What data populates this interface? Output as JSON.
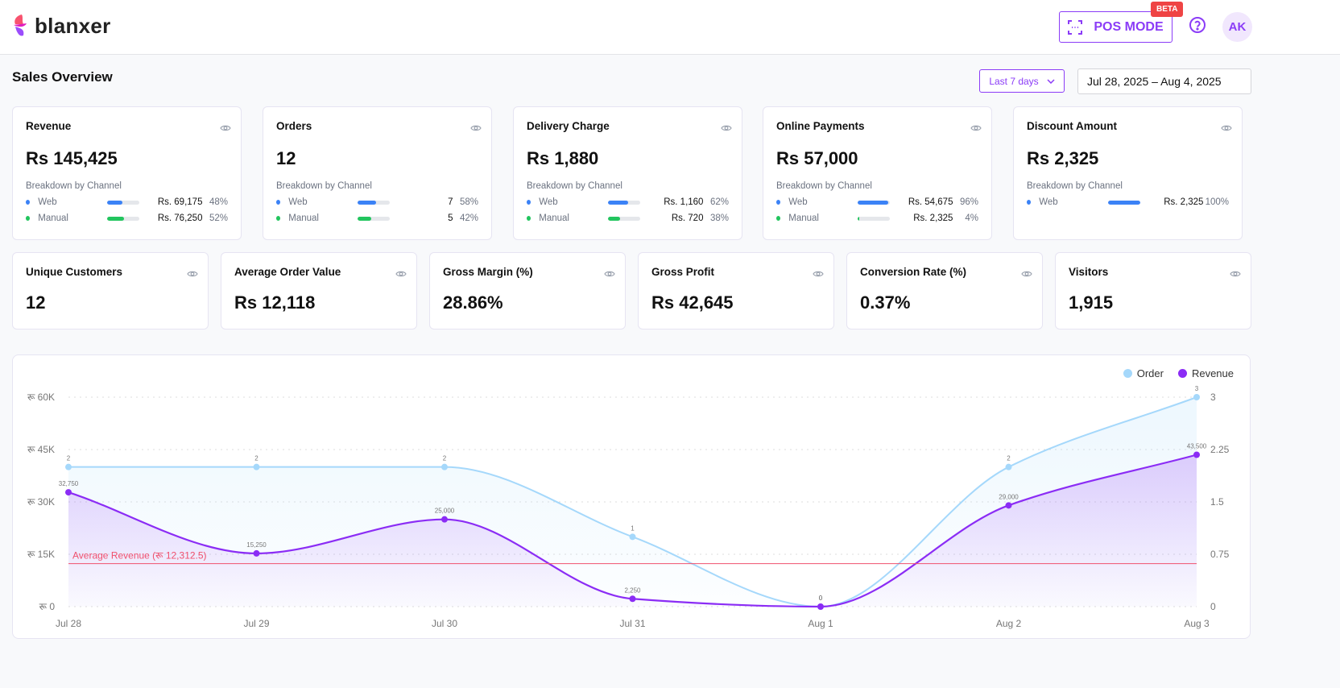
{
  "header": {
    "brand": "blanxer",
    "pos_label": "POS MODE",
    "beta_badge": "BETA",
    "avatar": "AK"
  },
  "page": {
    "title": "Sales Overview",
    "range_select": "Last 7 days",
    "date_range": "Jul 28, 2025 – Aug 4, 2025"
  },
  "colors": {
    "accent": "#8b3cf7",
    "web": "#3b82f6",
    "manual": "#22c55e",
    "order": "#a5d8fb",
    "revenue": "#8b2cf5",
    "average": "#f0506e"
  },
  "summary_cards": [
    {
      "title": "Revenue",
      "value": "Rs 145,425",
      "breakdown_label": "Breakdown by Channel",
      "rows": [
        {
          "label": "Web",
          "amount": "Rs. 69,175",
          "pct": "48%",
          "fill": 48
        },
        {
          "label": "Manual",
          "amount": "Rs. 76,250",
          "pct": "52%",
          "fill": 52
        }
      ]
    },
    {
      "title": "Orders",
      "value": "12",
      "breakdown_label": "Breakdown by Channel",
      "rows": [
        {
          "label": "Web",
          "amount": "7",
          "pct": "58%",
          "fill": 58
        },
        {
          "label": "Manual",
          "amount": "5",
          "pct": "42%",
          "fill": 42
        }
      ]
    },
    {
      "title": "Delivery Charge",
      "value": "Rs 1,880",
      "breakdown_label": "Breakdown by Channel",
      "rows": [
        {
          "label": "Web",
          "amount": "Rs. 1,160",
          "pct": "62%",
          "fill": 62
        },
        {
          "label": "Manual",
          "amount": "Rs. 720",
          "pct": "38%",
          "fill": 38
        }
      ]
    },
    {
      "title": "Online Payments",
      "value": "Rs 57,000",
      "breakdown_label": "Breakdown by Channel",
      "rows": [
        {
          "label": "Web",
          "amount": "Rs. 54,675",
          "pct": "96%",
          "fill": 96
        },
        {
          "label": "Manual",
          "amount": "Rs. 2,325",
          "pct": "4%",
          "fill": 4
        }
      ]
    },
    {
      "title": "Discount Amount",
      "value": "Rs 2,325",
      "breakdown_label": "Breakdown by Channel",
      "rows": [
        {
          "label": "Web",
          "amount": "Rs. 2,325",
          "pct": "100%",
          "fill": 100
        }
      ]
    }
  ],
  "metric_cards": [
    {
      "title": "Unique Customers",
      "value": "12"
    },
    {
      "title": "Average Order Value",
      "value": "Rs 12,118"
    },
    {
      "title": "Gross Margin (%)",
      "value": "28.86%"
    },
    {
      "title": "Gross Profit",
      "value": "Rs 42,645"
    },
    {
      "title": "Conversion Rate (%)",
      "value": "0.37%"
    },
    {
      "title": "Visitors",
      "value": "1,915"
    }
  ],
  "chart_data": {
    "type": "area",
    "categories": [
      "Jul 28",
      "Jul 29",
      "Jul 30",
      "Jul 31",
      "Aug 1",
      "Aug 2",
      "Aug 3"
    ],
    "series": [
      {
        "name": "Order",
        "axis": "right",
        "values": [
          2,
          2,
          2,
          1,
          0,
          2,
          3
        ],
        "labels": [
          "2",
          "2",
          "2",
          "1",
          "0",
          "2",
          "3"
        ]
      },
      {
        "name": "Revenue",
        "axis": "left",
        "values": [
          32750,
          15250,
          25000,
          2250,
          0,
          29000,
          43500
        ],
        "labels": [
          "32,750",
          "15,250",
          "25,000",
          "2,250",
          "0",
          "29,000",
          "43,500"
        ]
      }
    ],
    "y_left": {
      "ticks": [
        "रू 0",
        "रू 15K",
        "रू 30K",
        "रू 45K",
        "रू 60K"
      ],
      "range": [
        0,
        60000
      ]
    },
    "y_right": {
      "ticks": [
        "0",
        "0.75",
        "1.5",
        "2.25",
        "3"
      ],
      "range": [
        0,
        3
      ]
    },
    "average_line": {
      "value": 12312.5,
      "label": "Average Revenue (रू 12,312.5)"
    },
    "grid": "horizontal-dotted",
    "legend": "top-right"
  }
}
